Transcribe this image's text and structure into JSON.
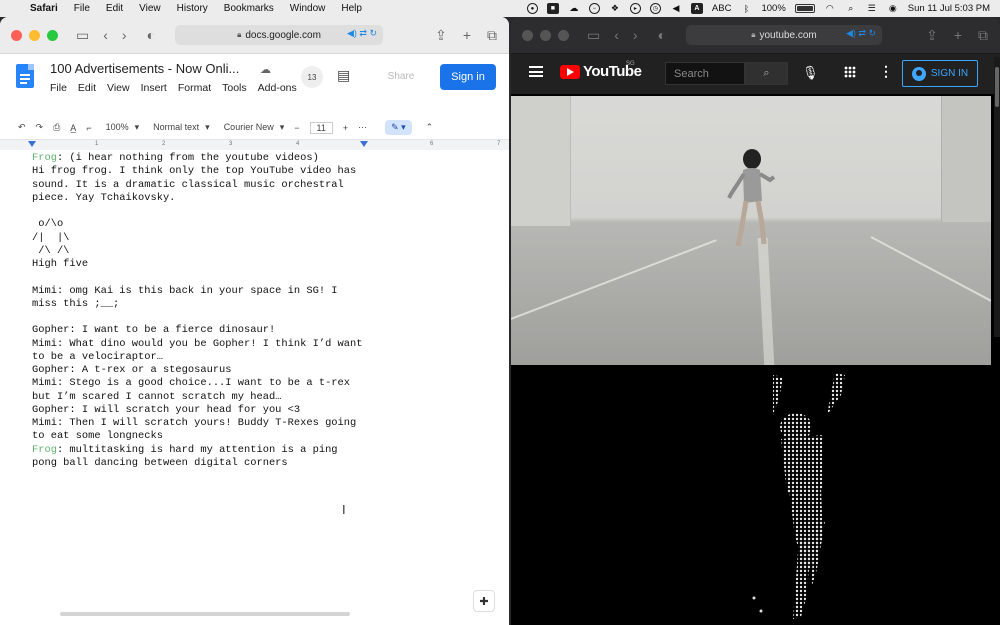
{
  "menubar": {
    "app_name": "Safari",
    "menus": [
      "File",
      "Edit",
      "View",
      "History",
      "Bookmarks",
      "Window",
      "Help"
    ],
    "status_icons": [
      "record-icon",
      "camera-icon",
      "cloud-icon",
      "no-entry-icon",
      "dropbox-icon",
      "play-icon",
      "history-icon",
      "volume-icon"
    ],
    "input_source": "ABC",
    "battery": "100%",
    "datetime": "Sun 11 Jul  5:03 PM"
  },
  "left_window": {
    "url": "docs.google.com",
    "doc_title": "100 Advertisements - Now Onli...",
    "doc_menus": [
      "File",
      "Edit",
      "View",
      "Insert",
      "Format",
      "Tools",
      "Add-ons"
    ],
    "collaborators_count": "13",
    "share_label": "Share",
    "signin_label": "Sign in",
    "toolbar": {
      "zoom": "100%",
      "style": "Normal text",
      "font": "Courier New",
      "font_size": "11",
      "minus": "−",
      "plus": "+"
    },
    "ruler_numbers": [
      "1",
      "2",
      "3",
      "4",
      "5",
      "6",
      "7"
    ],
    "lines": [
      {
        "speaker": "Frog",
        "text": ": (i hear nothing from the youtube videos)"
      },
      {
        "speaker": "",
        "text": "Hi frog frog. I think only the top YouTube video has"
      },
      {
        "speaker": "",
        "text": "sound. It is a dramatic classical music orchestral"
      },
      {
        "speaker": "",
        "text": "piece. Yay Tchaikovsky."
      },
      {
        "speaker": "",
        "text": ""
      },
      {
        "speaker": "",
        "text": " o/\\o"
      },
      {
        "speaker": "",
        "text": "/|  |\\"
      },
      {
        "speaker": "",
        "text": " /\\ /\\"
      },
      {
        "speaker": "",
        "text": "High five"
      },
      {
        "speaker": "",
        "text": ""
      },
      {
        "speaker": "",
        "text": "Mimi: omg Kai is this back in your space in SG! I"
      },
      {
        "speaker": "",
        "text": "miss this ;__;"
      },
      {
        "speaker": "",
        "text": ""
      },
      {
        "speaker": "",
        "text": "Gopher: I want to be a fierce dinosaur!"
      },
      {
        "speaker": "",
        "text": "Mimi: What dino would you be Gopher! I think I’d want"
      },
      {
        "speaker": "",
        "text": "to be a velociraptor…"
      },
      {
        "speaker": "",
        "text": "Gopher: A t-rex or a stegosaurus"
      },
      {
        "speaker": "",
        "text": "Mimi: Stego is a good choice...I want to be a t-rex"
      },
      {
        "speaker": "",
        "text": "but I’m scared I cannot scratch my head…"
      },
      {
        "speaker": "",
        "text": "Gopher: I will scratch your head for you <3"
      },
      {
        "speaker": "",
        "text": "Mimi: Then I will scratch yours! Buddy T-Rexes going"
      },
      {
        "speaker": "",
        "text": "to eat some longnecks"
      },
      {
        "speaker": "Frog",
        "text": ": multitasking is hard my attention is a ping"
      },
      {
        "speaker": "",
        "text": "pong ball dancing between digital corners"
      }
    ]
  },
  "right_window": {
    "url": "youtube.com",
    "logo_text": "YouTube",
    "region": "SG",
    "search_placeholder": "Search",
    "signin_label": "SIGN IN"
  },
  "colors": {
    "docs_blue": "#1a73e8",
    "frog_green": "#5fb46d",
    "youtube_red": "#ff0000",
    "youtube_signin": "#3ea6ff"
  }
}
